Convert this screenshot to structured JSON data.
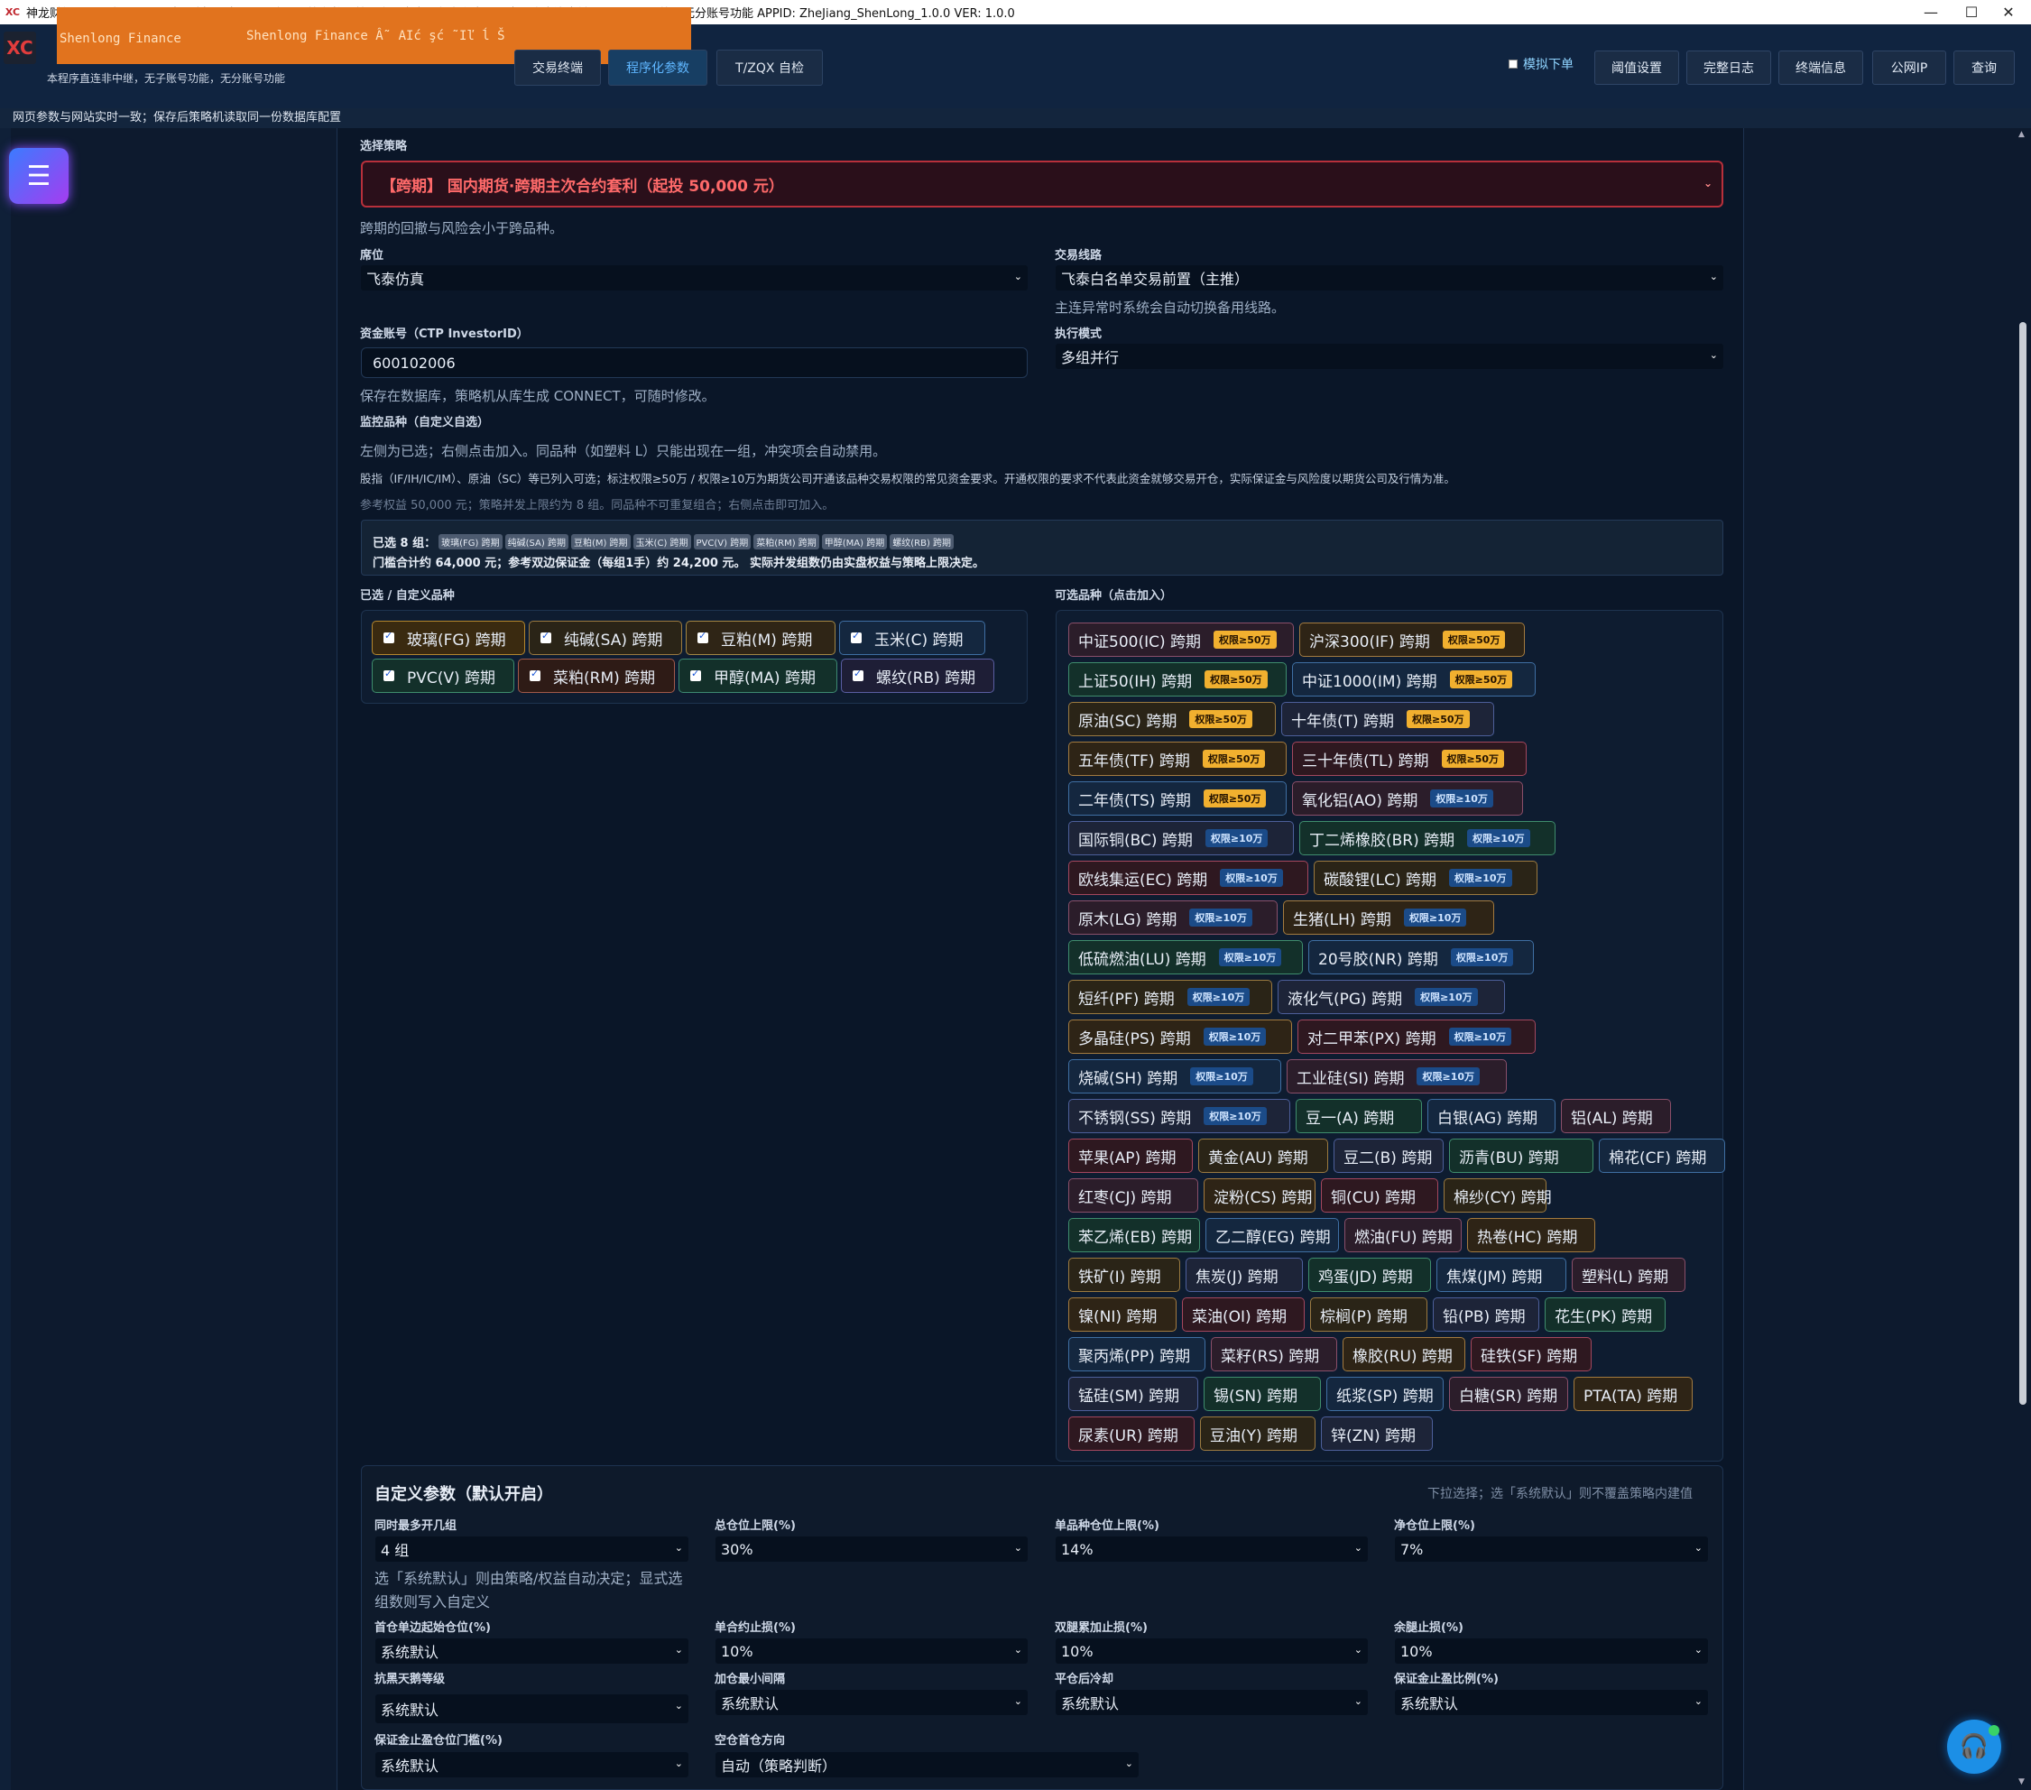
{
  "window": {
    "title": "神龙财经 - 只要登录设置品种、选择、步骤、加仓间隔等参数，就可实现全自动化套利交易。本程序直连中继，无子账号功能，无分账号功能 APPID:  ZheJiang_ShenLong_1.0.0  VER:  1.0.0",
    "minimize": "—",
    "maximize": "☐",
    "close": "✕"
  },
  "overlay": {
    "text1": "Shenlong Finance",
    "text2": "Shenlong Finance Â˜ AIć şć ˜Iľ ĺ Š"
  },
  "app": {
    "logo_text": "XC",
    "subtitle": "本程序直连非中继，无子账号功能，无分账号功能"
  },
  "nav": {
    "tabs": [
      "交易终端",
      "程序化参数",
      "T/ZQX 自检"
    ]
  },
  "toolbar": {
    "sim_label": "模拟下单",
    "buttons": [
      "阈值设置",
      "完整日志",
      "终端信息",
      "公网IP",
      "查询"
    ]
  },
  "infobar": "网页参数与网站实时一致；保存后策略机读取同一份数据库配置",
  "form": {
    "strategy_label": "选择策略",
    "strategy_value": "【跨期】 国内期货·跨期主次合约套利（起投 50,000 元）",
    "strategy_hint": "跨期的回撤与风险会小于跨品种。",
    "broker_label": "席位",
    "broker_value": "飞泰仿真",
    "route_label": "交易线路",
    "route_value": "飞泰白名单交易前置（主推）",
    "route_hint": "主连异常时系统会自动切换备用线路。",
    "account_label": "资金账号（CTP InvestorID）",
    "account_value": "600102006",
    "account_hint": "保存在数据库，策略机从库生成 CONNECT，可随时修改。",
    "mode_label": "执行模式",
    "mode_value": "多组并行",
    "monitor_label": "监控品种（自定义自选）",
    "monitor_hint1": "左侧为已选；右侧点击加入。同品种（如塑料 L）只能出现在一组，冲突项会自动禁用。",
    "monitor_hint2": "股指（IF/IH/IC/IM）、原油（SC）等已列入可选；标注权限≥50万 / 权限≥10万为期货公司开通该品种交易权限的常见资金要求。开通权限的要求不代表此资金就够交易开仓，实际保证金与风险度以期货公司及行情为准。",
    "monitor_hint3": "参考权益 50,000 元；策略并发上限约为 8 组。同品种不可重复组合；右侧点击即可加入。"
  },
  "summary": {
    "line1_prefix": "已选 8 组：",
    "chips": [
      "玻璃(FG) 跨期",
      "纯碱(SA) 跨期",
      "豆粕(M) 跨期",
      "玉米(C) 跨期",
      "PVC(V) 跨期",
      "菜粕(RM) 跨期",
      "甲醇(MA) 跨期",
      "螺纹(RB) 跨期"
    ],
    "line2": "门槛合计约 64,000 元；参考双边保证金（每组1手）约 24,200 元。 实际并发组数仍由实盘权益与策略上限决定。"
  },
  "selected_label": "已选 / 自定义品种",
  "available_label": "可选品种（点击加入）",
  "selected": [
    "玻璃(FG) 跨期",
    "纯碱(SA) 跨期",
    "豆粕(M) 跨期",
    "玉米(C) 跨期",
    "PVC(V) 跨期",
    "菜粕(RM) 跨期",
    "甲醇(MA) 跨期",
    "螺纹(RB) 跨期"
  ],
  "badges": {
    "b50": "权限≥50万",
    "b10": "权限≥10万"
  },
  "available": [
    [
      "中证500(IC) 跨期",
      "沪深300(IF) 跨期"
    ],
    [
      "上证50(IH) 跨期",
      "中证1000(IM) 跨期"
    ],
    [
      "原油(SC) 跨期",
      "十年债(T) 跨期"
    ],
    [
      "五年债(TF) 跨期",
      "三十年债(TL) 跨期"
    ],
    [
      "二年债(TS) 跨期",
      "氧化铝(AO) 跨期"
    ],
    [
      "国际铜(BC) 跨期",
      "丁二烯橡胶(BR) 跨期"
    ],
    [
      "欧线集运(EC) 跨期",
      "碳酸锂(LC) 跨期"
    ],
    [
      "原木(LG) 跨期",
      "生猪(LH) 跨期"
    ],
    [
      "低硫燃油(LU) 跨期",
      "20号胶(NR) 跨期"
    ],
    [
      "短纤(PF) 跨期",
      "液化气(PG) 跨期"
    ],
    [
      "多晶硅(PS) 跨期",
      "对二甲苯(PX) 跨期"
    ],
    [
      "烧碱(SH) 跨期",
      "工业硅(SI) 跨期"
    ],
    [
      "不锈钢(SS) 跨期",
      "豆一(A) 跨期",
      "白银(AG) 跨期",
      "铝(AL) 跨期"
    ],
    [
      "苹果(AP) 跨期",
      "黄金(AU) 跨期",
      "豆二(B) 跨期",
      "沥青(BU) 跨期",
      "棉花(CF) 跨期"
    ],
    [
      "红枣(CJ) 跨期",
      "淀粉(CS) 跨期",
      "铜(CU) 跨期",
      "棉纱(CY) 跨期"
    ],
    [
      "苯乙烯(EB) 跨期",
      "乙二醇(EG) 跨期",
      "燃油(FU) 跨期",
      "热卷(HC) 跨期"
    ],
    [
      "铁矿(I) 跨期",
      "焦炭(J) 跨期",
      "鸡蛋(JD) 跨期",
      "焦煤(JM) 跨期",
      "塑料(L) 跨期"
    ],
    [
      "镍(NI) 跨期",
      "菜油(OI) 跨期",
      "棕榈(P) 跨期",
      "铅(PB) 跨期",
      "花生(PK) 跨期"
    ],
    [
      "聚丙烯(PP) 跨期",
      "菜籽(RS) 跨期",
      "橡胶(RU) 跨期",
      "硅铁(SF) 跨期"
    ],
    [
      "锰硅(SM) 跨期",
      "锡(SN) 跨期",
      "纸浆(SP) 跨期",
      "白糖(SR) 跨期",
      "PTA(TA) 跨期"
    ],
    [
      "尿素(UR) 跨期",
      "豆油(Y) 跨期",
      "锌(ZN) 跨期"
    ]
  ],
  "custom_params": {
    "title": "自定义参数（默认开启）",
    "hint": "下拉选择；选「系统默认」则不覆盖策略内建值",
    "max_groups_label": "同时最多开几组",
    "max_groups_value": "4 组",
    "max_groups_hint": "选「系统默认」则由策略/权益自动决定；显式选组数则写入自定义",
    "total_pos_label": "总仓位上限(%)",
    "total_pos_value": "30%",
    "single_pos_label": "单品种仓位上限(%)",
    "single_pos_value": "14%",
    "net_pos_label": "净仓位上限(%)",
    "net_pos_value": "7%",
    "first_open_label": "首仓单边起始仓位(%)",
    "first_open_value": "系统默认",
    "single_stop_label": "单合约止损(%)",
    "single_stop_value": "10%",
    "dual_stop_label": "双腿累加止损(%)",
    "dual_stop_value": "10%",
    "leg_stop_label": "余腿止损(%)",
    "leg_stop_value": "10%",
    "black_swan_label": "抗黑天鹅等级",
    "black_swan_value": "系统默认",
    "min_interval_label": "加仓最小间隔",
    "min_interval_value": "系统默认",
    "cooldown_label": "平仓后冷却",
    "cooldown_value": "系统默认",
    "margin_ratio_label": "保证金止盈比例(%)",
    "margin_ratio_value": "系统默认",
    "margin_thresh_label": "保证金止盈仓位门槛(%)",
    "margin_thresh_value": "系统默认",
    "direction_label": "空仓首仓方向",
    "direction_value": "自动（策略判断）"
  },
  "colors": {
    "bg": "#0d1a2e",
    "danger": "#b8303b",
    "accent": "#1c8fe6"
  }
}
